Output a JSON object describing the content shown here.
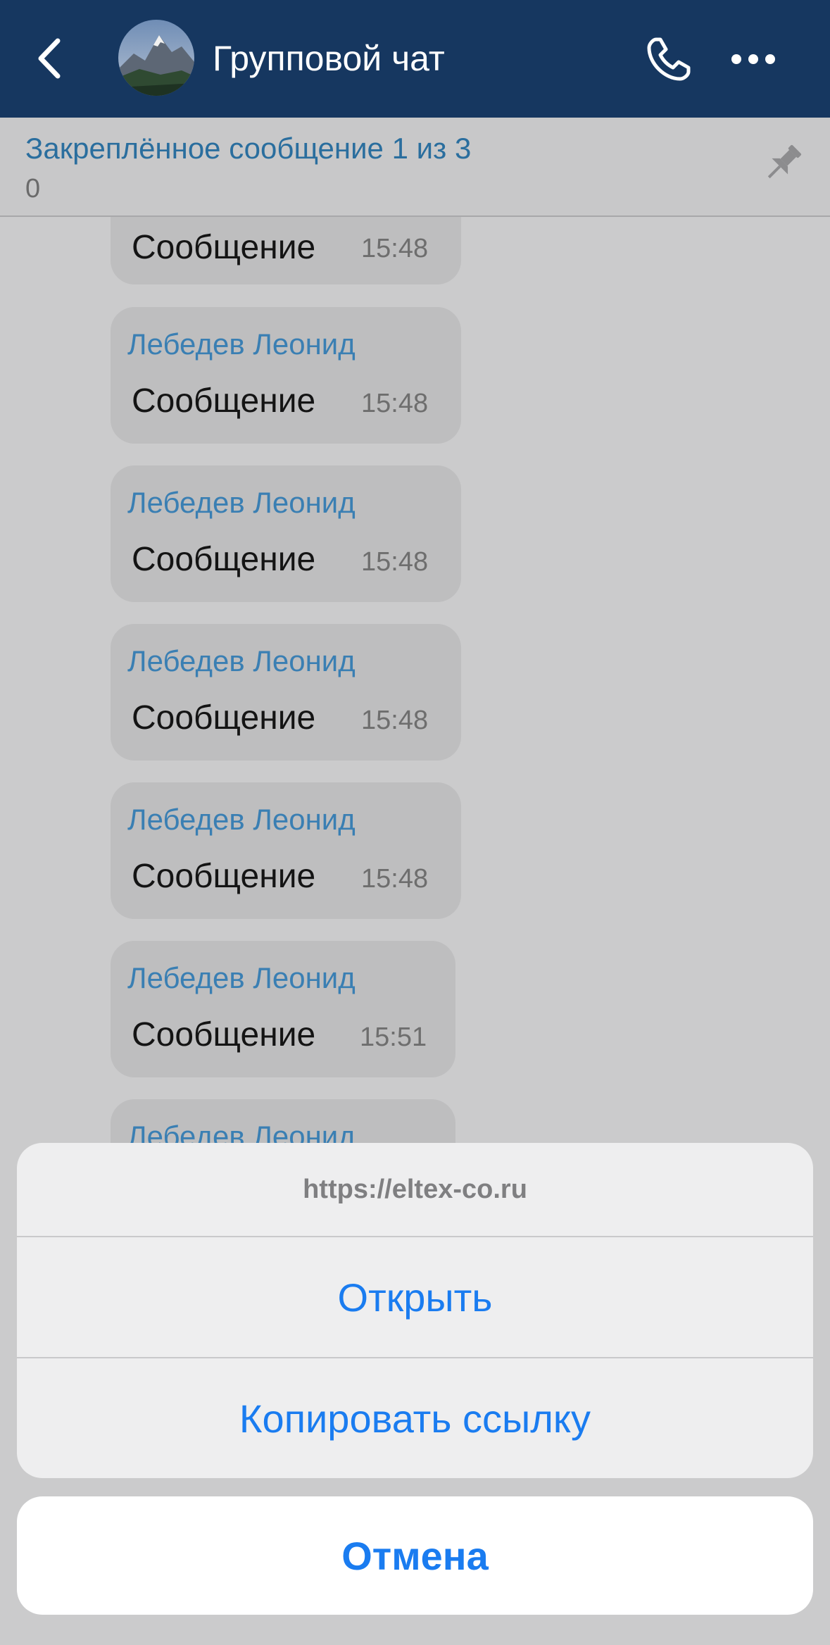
{
  "header": {
    "title": "Групповой чат",
    "back_icon": "chevron-left-icon",
    "call_icon": "phone-icon",
    "more_icon": "ellipsis-icon",
    "background_color": "#163760"
  },
  "pinned": {
    "title": "Закреплённое сообщение 1 из 3",
    "text": "0",
    "icon": "pin-icon"
  },
  "messages": [
    {
      "author": "",
      "text": "Сообщение",
      "time": "15:48"
    },
    {
      "author": "Лебедев Леонид",
      "text": "Сообщение",
      "time": "15:48"
    },
    {
      "author": "Лебедев Леонид",
      "text": "Сообщение",
      "time": "15:48"
    },
    {
      "author": "Лебедев Леонид",
      "text": "Сообщение",
      "time": "15:48"
    },
    {
      "author": "Лебедев Леонид",
      "text": "Сообщение",
      "time": "15:48"
    },
    {
      "author": "Лебедев Леонид",
      "text": "Сообщение",
      "time": "15:51"
    },
    {
      "author": "Лебедев Леонид",
      "text": "",
      "time": ""
    }
  ],
  "action_sheet": {
    "url": "https://eltex-co.ru",
    "open_label": "Открыть",
    "copy_label": "Копировать ссылку",
    "cancel_label": "Отмена",
    "accent_color": "#1a7cf0"
  }
}
